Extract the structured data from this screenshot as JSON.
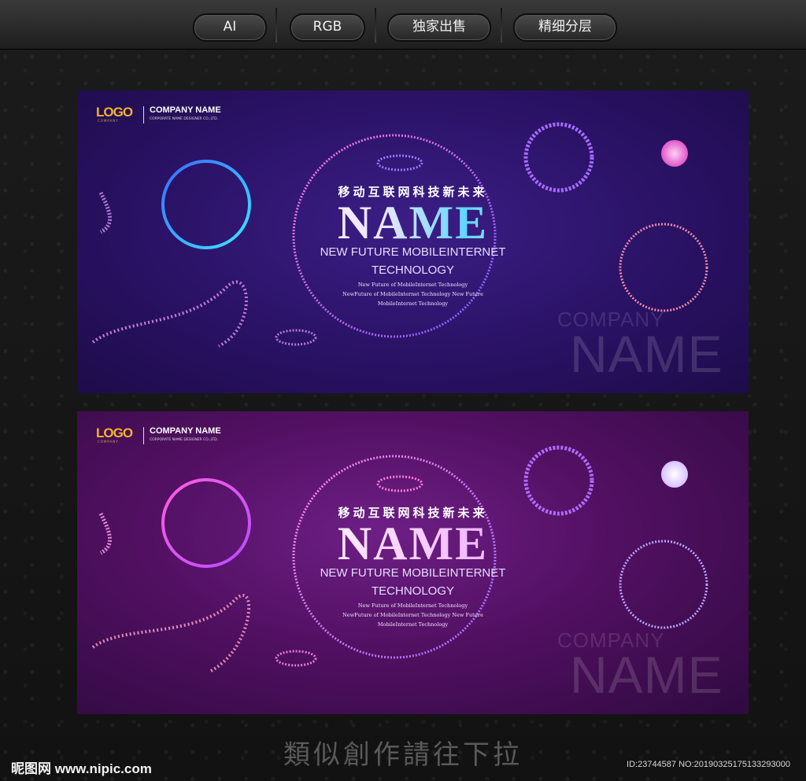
{
  "toolbar": {
    "buttons": [
      {
        "label": "AI"
      },
      {
        "label": "RGB"
      },
      {
        "label": "独家出售"
      },
      {
        "label": "精细分层"
      }
    ]
  },
  "banners": [
    {
      "logo": "LOGO",
      "logo_sub": "COMPANY",
      "company": "COMPANY NAME",
      "company_sub": "CORPORATE NAME DESIGNER CO.,LTD.",
      "cn_title": "移动互联网科技新未来",
      "name": "NAME",
      "line1": "NEW FUTURE MOBILEINTERNET",
      "line2": "TECHNOLOGY",
      "small1": "New Future of MobileInternet Technology",
      "small2": "NewFuture of MobileInternet Technology New Future",
      "small3": "MobileInternet Technology",
      "ghost_company": "COMPANY",
      "ghost_name": "NAME"
    },
    {
      "logo": "LOGO",
      "logo_sub": "COMPANY",
      "company": "COMPANY NAME",
      "company_sub": "CORPORATE NAME DESIGNER CO.,LTD.",
      "cn_title": "移动互联网科技新未来",
      "name": "NAME",
      "line1": "NEW FUTURE MOBILEINTERNET",
      "line2": "TECHNOLOGY",
      "small1": "New Future of MobileInternet Technology",
      "small2": "NewFuture of MobileInternet Technology New Future",
      "small3": "MobileInternet Technology",
      "ghost_company": "COMPANY",
      "ghost_name": "NAME"
    }
  ],
  "bottom_hint": "類似創作請往下拉",
  "footer": {
    "site": "昵图网 www.nipic.com",
    "id": "ID:23744587 NO:20190325175133293000"
  },
  "colors": {
    "banner1_bg": "#2a1265",
    "banner2_bg": "#521062",
    "logo_gold": "#f3b42a"
  }
}
